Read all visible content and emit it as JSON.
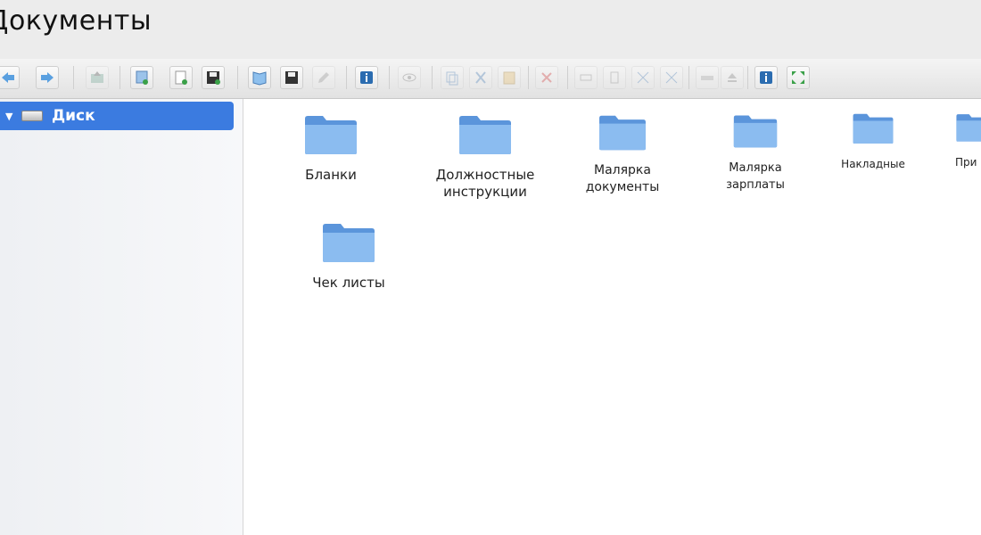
{
  "window": {
    "title": "Документы"
  },
  "toolbar": {
    "buttons": [
      {
        "id": "back",
        "icon": "arrow-left-icon",
        "enabled": true
      },
      {
        "id": "forward",
        "icon": "arrow-right-icon",
        "enabled": true
      },
      {
        "id": "up",
        "icon": "folder-up-icon",
        "enabled": false
      },
      {
        "id": "new-folder",
        "icon": "new-folder-icon",
        "enabled": true
      },
      {
        "id": "new-file",
        "icon": "new-file-icon",
        "enabled": true
      },
      {
        "id": "save",
        "icon": "save-icon",
        "enabled": true
      },
      {
        "id": "open",
        "icon": "book-icon",
        "enabled": true
      },
      {
        "id": "save-as",
        "icon": "save-icon",
        "enabled": true
      },
      {
        "id": "edit",
        "icon": "pencil-icon",
        "enabled": false
      },
      {
        "id": "info",
        "icon": "info-icon",
        "enabled": true
      },
      {
        "id": "view",
        "icon": "eye-icon",
        "enabled": false
      },
      {
        "id": "copy",
        "icon": "copy-icon",
        "enabled": false
      },
      {
        "id": "cut",
        "icon": "cut-icon",
        "enabled": false
      },
      {
        "id": "paste",
        "icon": "paste-icon",
        "enabled": false
      },
      {
        "id": "delete",
        "icon": "delete-icon",
        "enabled": false
      },
      {
        "id": "rename",
        "icon": "rename-icon",
        "enabled": false
      },
      {
        "id": "properties",
        "icon": "properties-icon",
        "enabled": false
      },
      {
        "id": "compress",
        "icon": "compress-icon",
        "enabled": false
      },
      {
        "id": "extract",
        "icon": "extract-icon",
        "enabled": false
      },
      {
        "id": "drive",
        "icon": "drive-icon",
        "enabled": false
      },
      {
        "id": "eject",
        "icon": "eject-icon",
        "enabled": false
      },
      {
        "id": "help",
        "icon": "help-icon",
        "enabled": true
      },
      {
        "id": "fullscreen",
        "icon": "fullscreen-icon",
        "enabled": true
      }
    ]
  },
  "sidebar": {
    "items": [
      {
        "label": "Диск",
        "icon": "drive-icon",
        "expanded": true,
        "selected": true
      }
    ]
  },
  "main": {
    "folders": [
      {
        "label": "Бланки",
        "icon": "folder-icon"
      },
      {
        "label": "Должностные инструкции",
        "icon": "folder-icon"
      },
      {
        "label": "Малярка документы",
        "icon": "folder-icon"
      },
      {
        "label": "Малярка зарплаты",
        "icon": "folder-icon"
      },
      {
        "label": "Накладные",
        "icon": "folder-icon"
      },
      {
        "label": "При",
        "icon": "folder-icon"
      },
      {
        "label": "Чек листы",
        "icon": "folder-icon"
      }
    ]
  },
  "colors": {
    "selection": "#3b7be0",
    "folder": "#7fb2ec",
    "folder_dark": "#5b95db",
    "toolbar_accent": "#2b6cb0",
    "green": "#3aa048",
    "red": "#d23c3c"
  }
}
